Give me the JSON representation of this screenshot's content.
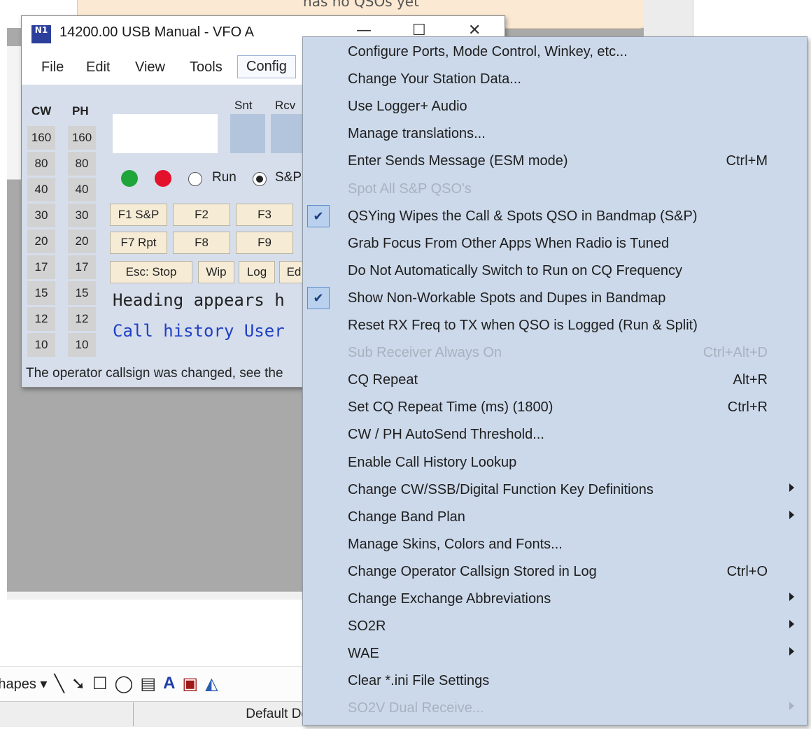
{
  "background": {
    "top_note": "has no QSOs yet",
    "toolbar": {
      "shapes_label": "Shapes",
      "icons": [
        "line-icon",
        "arrow-icon",
        "rectangle-icon",
        "oval-icon",
        "textbox-icon",
        "wordart-icon",
        "picture-icon",
        "fill-color-icon"
      ]
    },
    "status_cell": "Default De"
  },
  "logger": {
    "title": "14200.00 USB Manual - VFO A",
    "app_icon": "N1",
    "menu": [
      "File",
      "Edit",
      "View",
      "Tools",
      "Config"
    ],
    "band_headers": {
      "cw": "CW",
      "ph": "PH"
    },
    "bands": [
      "160",
      "80",
      "40",
      "30",
      "20",
      "17",
      "15",
      "12",
      "10"
    ],
    "rst_labels": {
      "snt": "Snt",
      "rcv": "Rcv"
    },
    "mode_radios": {
      "run": "Run",
      "sp": "S&P"
    },
    "fkeys_row1": [
      "F1 S&P",
      "F2",
      "F3"
    ],
    "fkeys_row2": [
      "F7 Rpt",
      "F8",
      "F9"
    ],
    "fkeys_row3": [
      "Esc: Stop",
      "Wip",
      "Log",
      "Ed"
    ],
    "heading_line": "Heading appears h",
    "call_history_line": "Call history User",
    "status_line": "The operator callsign was changed, see the"
  },
  "context_menu": {
    "items": [
      {
        "label": "Configure Ports, Mode Control, Winkey, etc...",
        "shortcut": "",
        "checked": false,
        "disabled": false,
        "submenu": false
      },
      {
        "label": "Change Your Station Data...",
        "shortcut": "",
        "checked": false,
        "disabled": false,
        "submenu": false
      },
      {
        "label": "Use Logger+ Audio",
        "shortcut": "",
        "checked": false,
        "disabled": false,
        "submenu": false
      },
      {
        "label": "Manage translations...",
        "shortcut": "",
        "checked": false,
        "disabled": false,
        "submenu": false
      },
      {
        "label": "Enter Sends Message (ESM mode)",
        "shortcut": "Ctrl+M",
        "checked": false,
        "disabled": false,
        "submenu": false
      },
      {
        "label": "Spot All S&P QSO's",
        "shortcut": "",
        "checked": false,
        "disabled": true,
        "submenu": false
      },
      {
        "label": "QSYing Wipes the Call & Spots QSO in Bandmap (S&P)",
        "shortcut": "",
        "checked": true,
        "disabled": false,
        "submenu": false
      },
      {
        "label": "Grab Focus From Other Apps When Radio is Tuned",
        "shortcut": "",
        "checked": false,
        "disabled": false,
        "submenu": false
      },
      {
        "label": "Do Not Automatically Switch to Run on CQ Frequency",
        "shortcut": "",
        "checked": false,
        "disabled": false,
        "submenu": false
      },
      {
        "label": "Show Non-Workable Spots and Dupes in Bandmap",
        "shortcut": "",
        "checked": true,
        "disabled": false,
        "submenu": false
      },
      {
        "label": "Reset RX Freq to TX when QSO is Logged (Run & Split)",
        "shortcut": "",
        "checked": false,
        "disabled": false,
        "submenu": false
      },
      {
        "label": "Sub Receiver Always On",
        "shortcut": "Ctrl+Alt+D",
        "checked": false,
        "disabled": true,
        "submenu": false
      },
      {
        "label": "CQ Repeat",
        "shortcut": "Alt+R",
        "checked": false,
        "disabled": false,
        "submenu": false
      },
      {
        "label": "Set CQ Repeat Time (ms) (1800)",
        "shortcut": "Ctrl+R",
        "checked": false,
        "disabled": false,
        "submenu": false
      },
      {
        "label": "CW / PH AutoSend Threshold...",
        "shortcut": "",
        "checked": false,
        "disabled": false,
        "submenu": false
      },
      {
        "label": "Enable Call History Lookup",
        "shortcut": "",
        "checked": false,
        "disabled": false,
        "submenu": false
      },
      {
        "label": "Change CW/SSB/Digital Function Key Definitions",
        "shortcut": "",
        "checked": false,
        "disabled": false,
        "submenu": true
      },
      {
        "label": "Change Band Plan",
        "shortcut": "",
        "checked": false,
        "disabled": false,
        "submenu": true
      },
      {
        "label": "Manage Skins, Colors and Fonts...",
        "shortcut": "",
        "checked": false,
        "disabled": false,
        "submenu": false
      },
      {
        "label": "Change Operator Callsign Stored in Log",
        "shortcut": "Ctrl+O",
        "checked": false,
        "disabled": false,
        "submenu": false
      },
      {
        "label": "Change Exchange Abbreviations",
        "shortcut": "",
        "checked": false,
        "disabled": false,
        "submenu": true
      },
      {
        "label": "SO2R",
        "shortcut": "",
        "checked": false,
        "disabled": false,
        "submenu": true
      },
      {
        "label": "WAE",
        "shortcut": "",
        "checked": false,
        "disabled": false,
        "submenu": true
      },
      {
        "label": "Clear *.ini File Settings",
        "shortcut": "",
        "checked": false,
        "disabled": false,
        "submenu": false
      },
      {
        "label": "SO2V Dual Receive...",
        "shortcut": "",
        "checked": false,
        "disabled": true,
        "submenu": true
      }
    ]
  },
  "colors": {
    "menu_bg": "#ccd9ea",
    "led_green": "#1fa53a",
    "led_red": "#e3122a",
    "call_history_blue": "#1f3fc4"
  }
}
